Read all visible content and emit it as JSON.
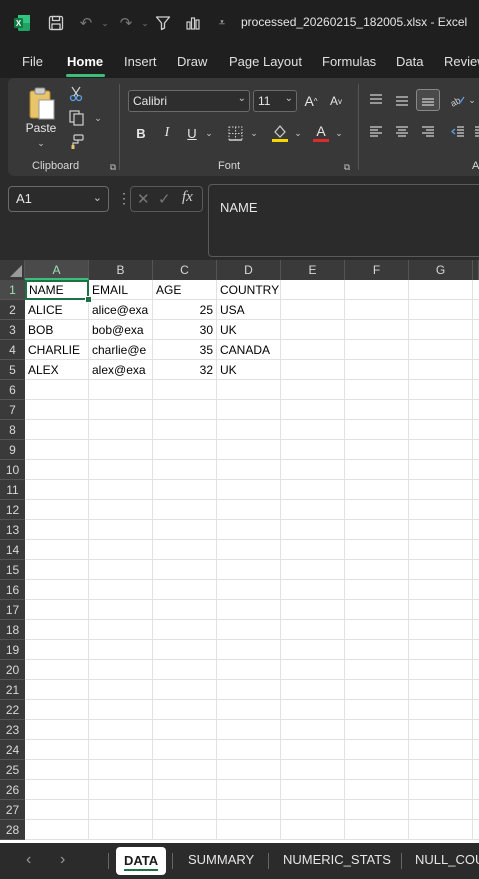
{
  "titlebar": {
    "title": "processed_20260215_182005.xlsx  -  Excel"
  },
  "menu": {
    "items": [
      "File",
      "Home",
      "Insert",
      "Draw",
      "Page Layout",
      "Formulas",
      "Data",
      "Review"
    ],
    "active": "Home"
  },
  "ribbon": {
    "clipboard": {
      "paste_label": "Paste",
      "group_label": "Clipboard"
    },
    "font": {
      "font_name": "Calibri",
      "font_size": "11",
      "group_label": "Font",
      "bold": "B",
      "italic": "I",
      "underline": "U",
      "font_color_letter": "A",
      "highlight_color": "#f4d800",
      "font_color": "#e02b2b"
    },
    "next_group_label": "A"
  },
  "formula_bar": {
    "name_box": "A1",
    "fx": "fx",
    "content": "NAME"
  },
  "grid": {
    "columns": [
      "A",
      "B",
      "C",
      "D",
      "E",
      "F",
      "G"
    ],
    "rows": [
      "1",
      "2",
      "3",
      "4",
      "5",
      "6",
      "7",
      "8",
      "9",
      "10",
      "11",
      "12",
      "13",
      "14",
      "15",
      "16",
      "17",
      "18",
      "19",
      "20",
      "21",
      "22",
      "23",
      "24",
      "25",
      "26",
      "27",
      "28"
    ],
    "data": [
      [
        "NAME",
        "EMAIL",
        "AGE",
        "COUNTRY"
      ],
      [
        "ALICE",
        "alice@exa",
        "25",
        "USA"
      ],
      [
        "BOB",
        "bob@exa",
        "30",
        "UK"
      ],
      [
        "CHARLIE",
        "charlie@e",
        "35",
        "CANADA"
      ],
      [
        "ALEX",
        "alex@exa",
        "32",
        "UK"
      ]
    ],
    "active_cell": "A1",
    "accent": "#1e7145"
  },
  "sheets": {
    "tabs": [
      "DATA",
      "SUMMARY",
      "NUMERIC_STATS",
      "NULL_COU"
    ],
    "active": "DATA"
  }
}
